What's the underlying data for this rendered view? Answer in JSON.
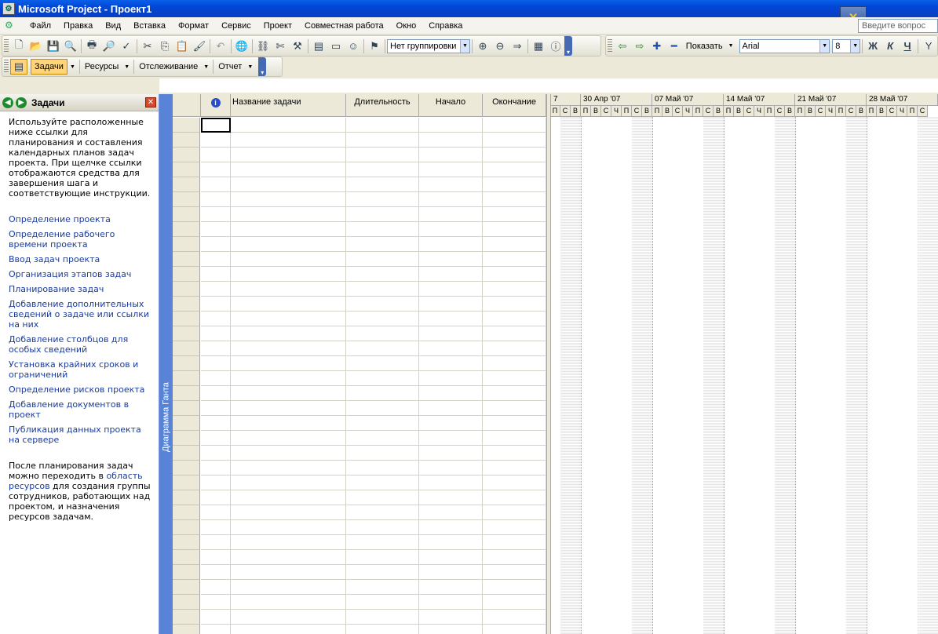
{
  "window": {
    "title": "Microsoft Project - Проект1",
    "help_placeholder": "Введите вопрос"
  },
  "menu": {
    "items": [
      "Файл",
      "Правка",
      "Вид",
      "Вставка",
      "Формат",
      "Сервис",
      "Проект",
      "Совместная работа",
      "Окно",
      "Справка"
    ]
  },
  "toolbar_standard": {
    "grouping": "Нет группировки"
  },
  "toolbar_formatting": {
    "show_label": "Показать",
    "font": "Arial",
    "font_size": "8",
    "bold": "Ж",
    "italic": "К",
    "underline": "Ч"
  },
  "toolbar_guide": {
    "tasks": "Задачи",
    "resources": "Ресурсы",
    "tracking": "Отслеживание",
    "report": "Отчет"
  },
  "task_pane": {
    "title": "Задачи",
    "intro": "Используйте расположенные ниже ссылки для планирования и составления календарных планов задач проекта. При щелчке ссылки отображаются средства для завершения шага и соответствующие инструкции.",
    "links": [
      "Определение проекта",
      "Определение рабочего времени проекта",
      "Ввод задач проекта",
      "Организация этапов задач",
      "Планирование задач",
      "Добавление дополнительных сведений о задаче или ссылки на них",
      "Добавление столбцов для особых сведений",
      "Установка крайних сроков и ограничений",
      "Определение рисков проекта",
      "Добавление документов в проект",
      "Публикация данных проекта на сервере"
    ],
    "footer_before": "После планирования задач можно переходить в ",
    "footer_link": "область ресурсов",
    "footer_after": " для создания группы сотрудников, работающих над проектом, и назначения ресурсов задачам."
  },
  "view_bar": {
    "label": "Диаграмма Ганта"
  },
  "table": {
    "columns": [
      "Название задачи",
      "Длительность",
      "Начало",
      "Окончание"
    ]
  },
  "gantt": {
    "partial_week": "7",
    "weeks": [
      "30 Апр '07",
      "07 Май '07",
      "14 Май '07",
      "21 Май '07",
      "28 Май '07"
    ],
    "days": [
      "П",
      "С",
      "В",
      "П",
      "В",
      "С",
      "Ч",
      "П",
      "С",
      "В",
      "П",
      "В",
      "С",
      "Ч",
      "П",
      "С",
      "В",
      "П",
      "В",
      "С",
      "Ч",
      "П",
      "С",
      "В",
      "П",
      "В",
      "С",
      "Ч",
      "П",
      "С",
      "В",
      "П",
      "В",
      "С",
      "Ч",
      "П",
      "С"
    ]
  }
}
